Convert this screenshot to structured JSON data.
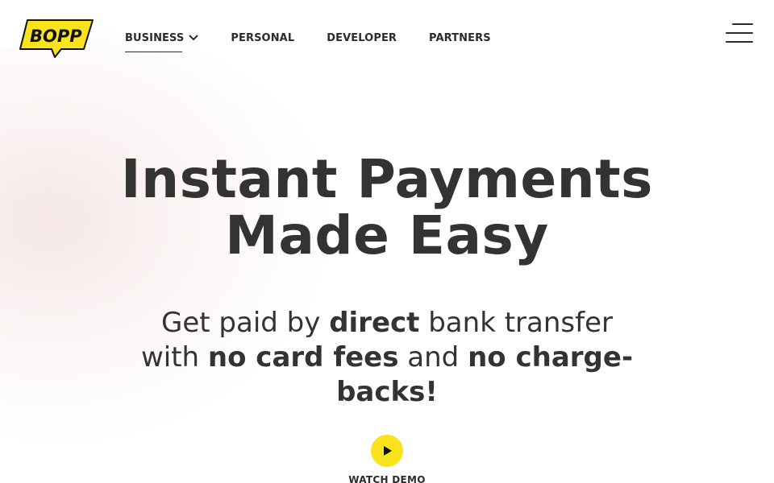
{
  "brand": {
    "logo_text": "BOPP",
    "logo_color": "#f8e31c"
  },
  "nav": {
    "items": [
      {
        "label": "BUSINESS",
        "has_dropdown": true,
        "active": true
      },
      {
        "label": "PERSONAL"
      },
      {
        "label": "DEVELOPER"
      },
      {
        "label": "PARTNERS"
      }
    ],
    "menu_icon": "hamburger-menu-icon"
  },
  "hero": {
    "title_line1": "Instant Payments",
    "title_line2": "Made Easy",
    "subtitle": {
      "part1": "Get paid by ",
      "bold1": "direct",
      "part2": " bank transfer with ",
      "bold2": "no card fees",
      "part3": " and ",
      "bold3": "no charge-backs!"
    }
  },
  "demo": {
    "icon": "play-icon",
    "label": "WATCH DEMO",
    "button_color": "#f8e31c"
  }
}
